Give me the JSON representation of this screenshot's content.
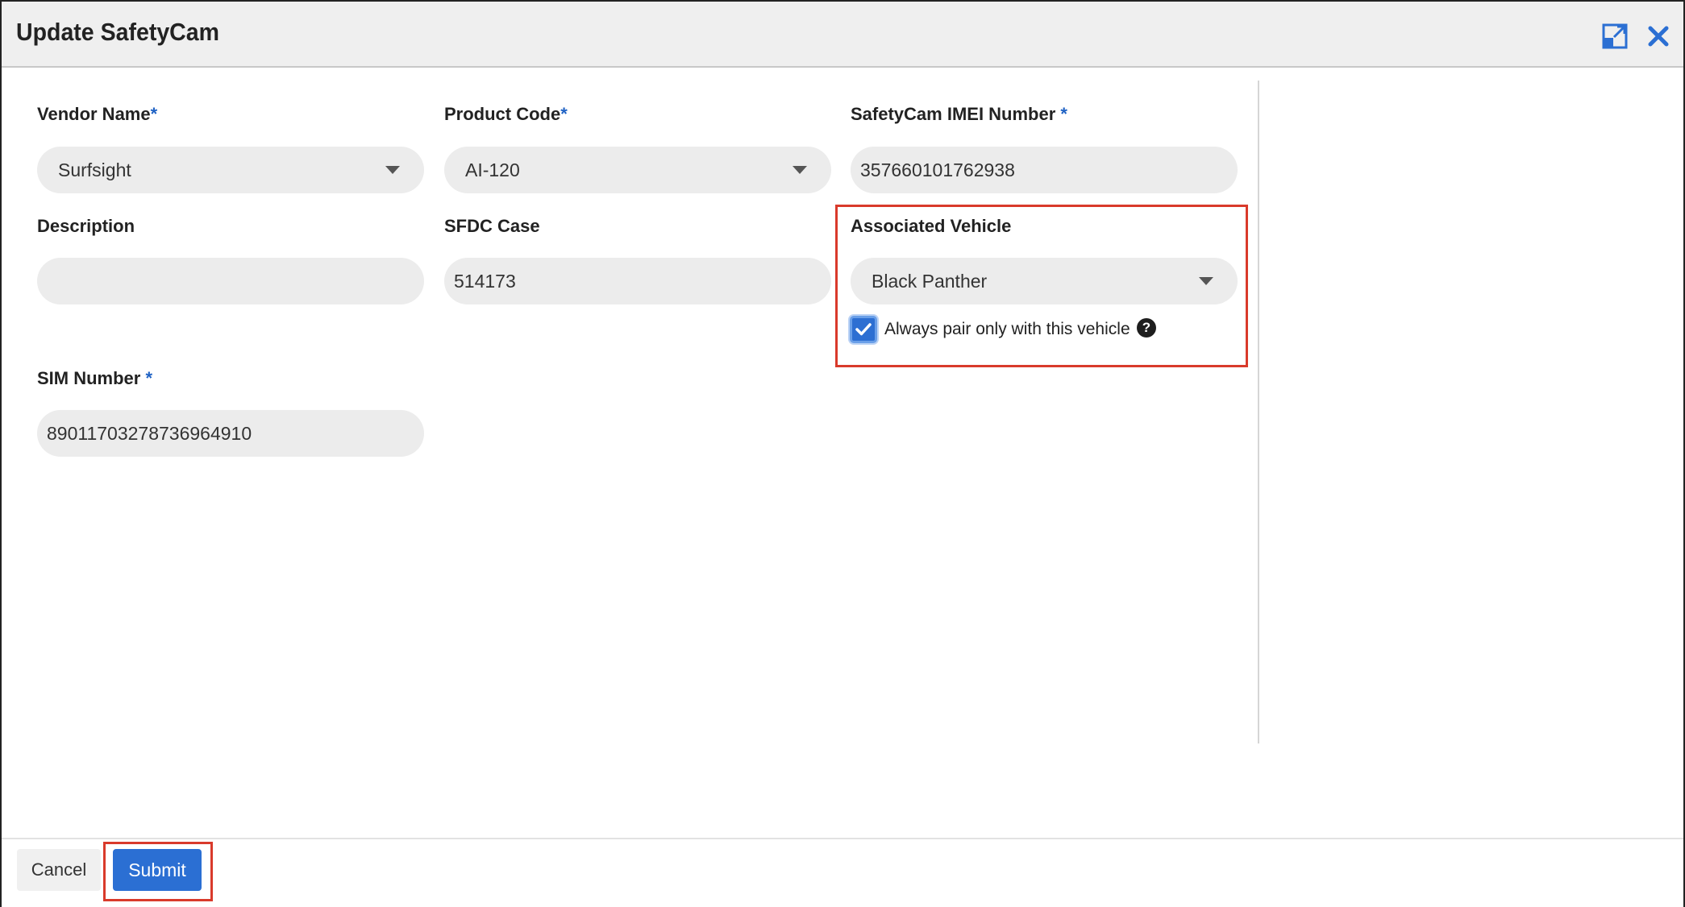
{
  "dialog": {
    "title": "Update SafetyCam",
    "icons": [
      "expand-icon",
      "close-icon"
    ]
  },
  "form": {
    "vendor_name": {
      "label": "Vendor Name",
      "required": "*",
      "value": "Surfsight"
    },
    "product_code": {
      "label": "Product Code",
      "required": "*",
      "value": "AI-120"
    },
    "imei": {
      "label": "SafetyCam IMEI Number",
      "required": "*",
      "value": "357660101762938"
    },
    "description": {
      "label": "Description",
      "value": ""
    },
    "sfdc_case": {
      "label": "SFDC Case",
      "value": "514173"
    },
    "associated_vehicle": {
      "label": "Associated Vehicle",
      "value": "Black Panther",
      "always_pair_label": "Always pair only with this vehicle",
      "always_pair_checked": true,
      "help_icon": "?"
    },
    "sim_number": {
      "label": "SIM Number",
      "required": "*",
      "value": "89011703278736964910"
    }
  },
  "footer": {
    "cancel_label": "Cancel",
    "submit_label": "Submit"
  },
  "colors": {
    "accent": "#2b6fd3",
    "highlight": "#d93a2b",
    "required": "#1f62c4"
  }
}
